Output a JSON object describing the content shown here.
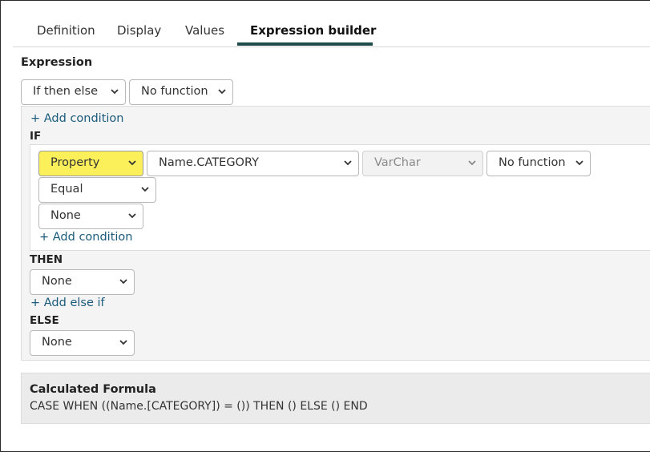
{
  "tabs": [
    {
      "label": "Definition"
    },
    {
      "label": "Display"
    },
    {
      "label": "Values"
    },
    {
      "label": "Expression builder"
    }
  ],
  "expression": {
    "heading": "Expression",
    "type_select": "If then else",
    "function_select": "No function"
  },
  "if_block": {
    "add_condition_top": "+ Add condition",
    "if_label": "IF",
    "condition": {
      "source_select": "Property",
      "property_select": "Name.CATEGORY",
      "datatype_select": "VarChar",
      "function_select": "No function",
      "operator_select": "Equal",
      "value_select": "None"
    },
    "add_condition_inner": "+ Add condition"
  },
  "then_block": {
    "label": "THEN",
    "value_select": "None",
    "add_else_if": "+ Add else if"
  },
  "else_block": {
    "label": "ELSE",
    "value_select": "None"
  },
  "calculated_formula": {
    "title": "Calculated Formula",
    "text": "CASE WHEN ((Name.[CATEGORY]) = ()) THEN () ELSE () END"
  },
  "colors": {
    "accent_underline": "#1e4a4a",
    "link": "#1a5a7a",
    "highlight": "#fbf05a"
  },
  "icons": {
    "dropdown": "chevron-down-icon"
  }
}
